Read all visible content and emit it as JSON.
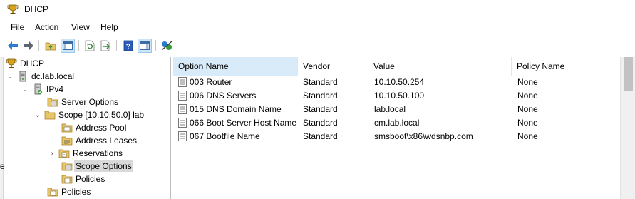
{
  "window": {
    "title": "DHCP"
  },
  "menu": {
    "file": "File",
    "action": "Action",
    "view": "View",
    "help": "Help"
  },
  "toolbar": {
    "buttons": [
      "back-icon",
      "forward-icon",
      "up-folder-icon",
      "show-hide-tree-icon",
      "refresh-icon",
      "export-list-icon",
      "help-icon",
      "action-pane-icon",
      "dhcp-tool-icon"
    ]
  },
  "tree": {
    "items": [
      {
        "label": "DHCP"
      },
      {
        "label": "dc.lab.local"
      },
      {
        "label": "IPv4"
      },
      {
        "label": "Server Options"
      },
      {
        "label": "Scope [10.10.50.0] lab"
      },
      {
        "label": "Address Pool"
      },
      {
        "label": "Address Leases"
      },
      {
        "label": "Reservations"
      },
      {
        "label": "Scope Options"
      },
      {
        "label": "Policies"
      },
      {
        "label": "Policies"
      }
    ],
    "selected": "Scope Options",
    "stray": "e"
  },
  "list": {
    "columns": [
      "Option Name",
      "Vendor",
      "Value",
      "Policy Name"
    ],
    "rows": [
      [
        "003 Router",
        "Standard",
        "10.10.50.254",
        "None"
      ],
      [
        "006 DNS Servers",
        "Standard",
        "10.10.50.100",
        "None"
      ],
      [
        "015 DNS Domain Name",
        "Standard",
        "lab.local",
        "None"
      ],
      [
        "066 Boot Server Host Name",
        "Standard",
        "cm.lab.local",
        "None"
      ],
      [
        "067 Bootfile Name",
        "Standard",
        "smsboot\\x86\\wdsnbp.com",
        "None"
      ]
    ]
  },
  "colors": {
    "selected_header": "#d9ebf9",
    "selected_tree": "#d9d9d9",
    "folder": "#e8c46a"
  }
}
